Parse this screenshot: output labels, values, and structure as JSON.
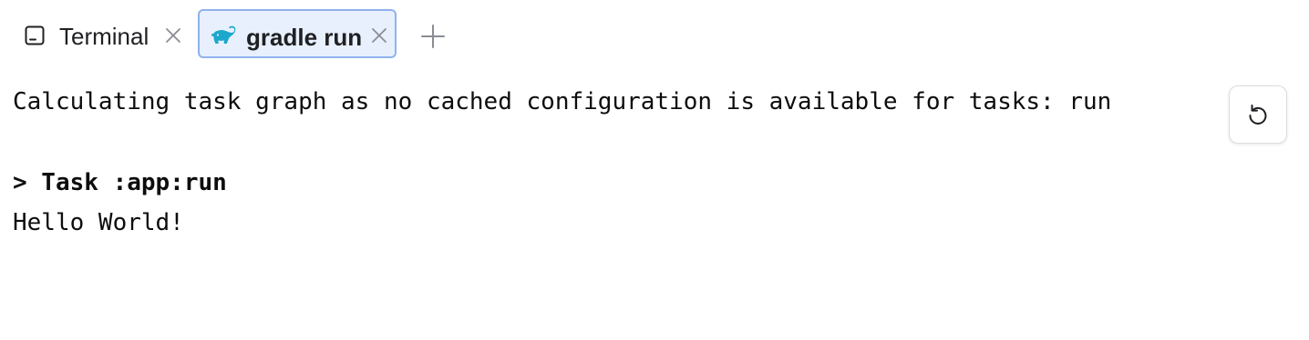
{
  "tabs": [
    {
      "label": "Terminal",
      "icon": "terminal-icon",
      "active": false
    },
    {
      "label": "gradle run",
      "icon": "gradle-elephant-icon",
      "active": true
    }
  ],
  "tabbar": {
    "new_tab_icon": "plus-icon",
    "close_icon": "close-icon"
  },
  "console": {
    "lines": [
      "Calculating task graph as no cached configuration is available for tasks: run",
      "> Task :app:run",
      "Hello World!"
    ]
  },
  "actions": {
    "rerun_icon": "rerun-icon"
  },
  "colors": {
    "active_tab_background": "#e8f0fd",
    "active_tab_border": "#8fb2ee",
    "gradle_icon": "#1ba8cb"
  }
}
